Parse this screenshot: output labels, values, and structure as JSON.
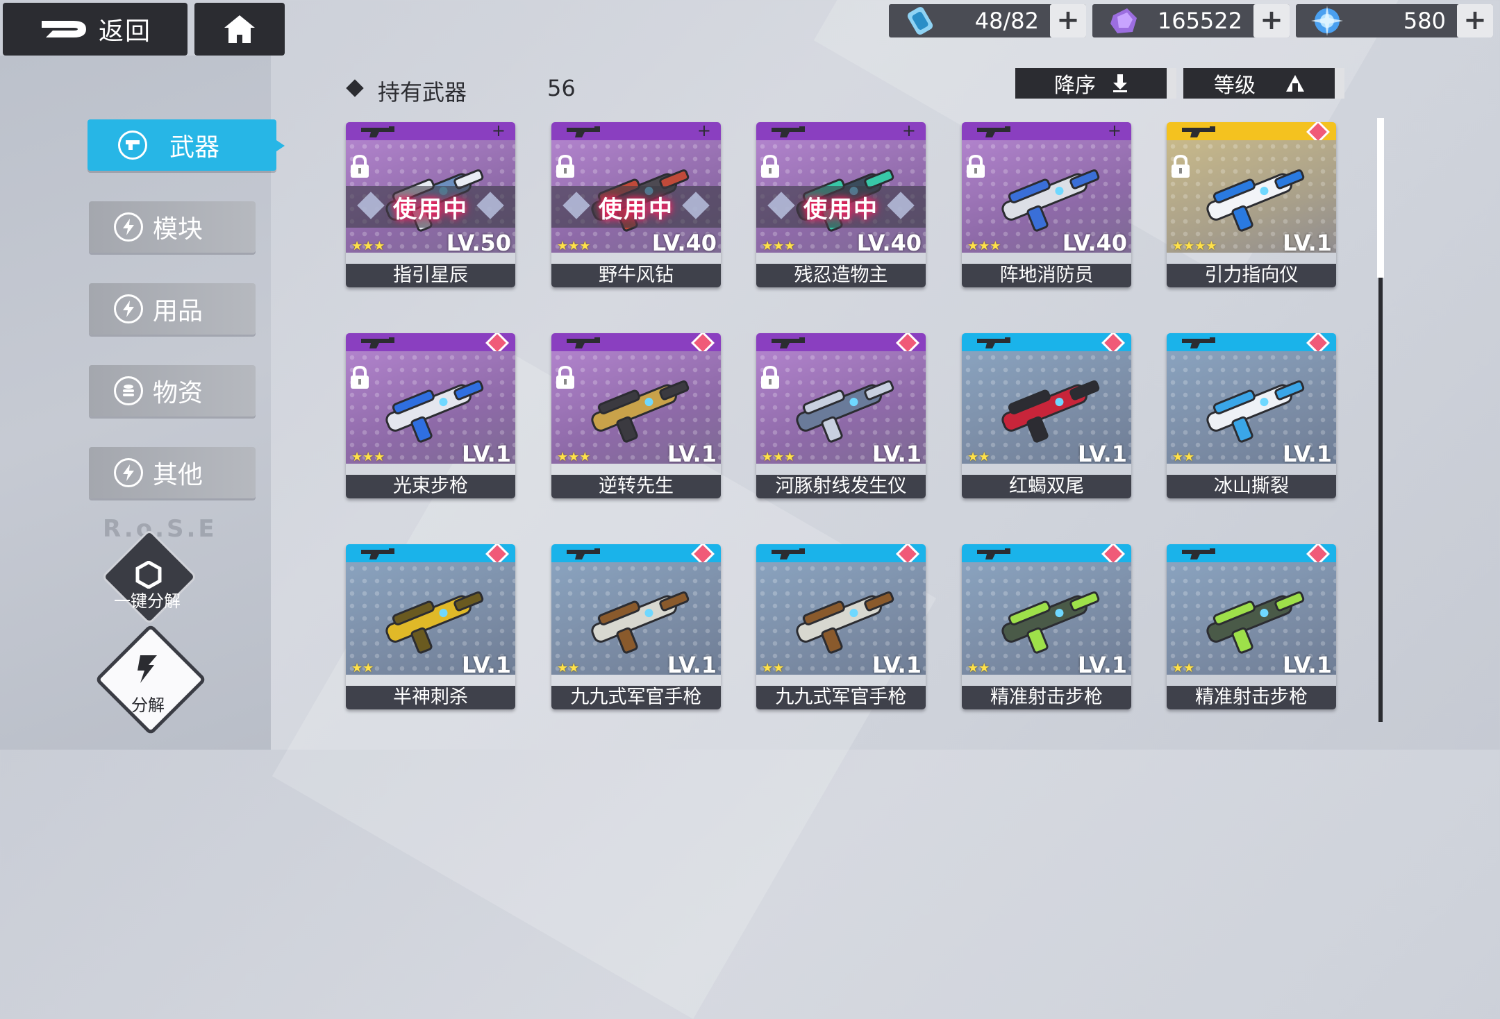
{
  "topbar": {
    "back_label": "返回"
  },
  "resources": [
    {
      "name": "stamina",
      "icon": "hourglass-icon",
      "value": "48/82",
      "color": "#57b8e6"
    },
    {
      "name": "crystal",
      "icon": "crystal-icon",
      "value": "165522",
      "color": "#9c6ee0"
    },
    {
      "name": "orb",
      "icon": "orb-icon",
      "value": "580",
      "color": "#4aa0f0"
    }
  ],
  "sidebar": {
    "items": [
      {
        "label": "武器",
        "icon": "gun-icon",
        "active": true
      },
      {
        "label": "模块",
        "icon": "bolt-icon"
      },
      {
        "label": "用品",
        "icon": "bolt-icon"
      },
      {
        "label": "物资",
        "icon": "stack-icon"
      },
      {
        "label": "其他",
        "icon": "bolt-icon"
      }
    ],
    "one_click_label": "一键分解",
    "decompose_label": "分解",
    "watermark": "R.o.S.E"
  },
  "header": {
    "title": "持有武器",
    "count": "56"
  },
  "sort": {
    "order_label": "降序",
    "type_label": "等级"
  },
  "in_use_label": "使用中",
  "rarity_colors": {
    "purple": "#8a3fc0",
    "gold": "#f4c21f",
    "blue": "#1ab3ea"
  },
  "weapons": [
    {
      "name": "指引星辰",
      "level": "LV.50",
      "stars": "★★★",
      "rarity": "purple",
      "in_use": true,
      "locked": true,
      "mark": "plus"
    },
    {
      "name": "野牛风钻",
      "level": "LV.40",
      "stars": "★★★",
      "rarity": "purple",
      "in_use": true,
      "locked": true,
      "mark": "plus"
    },
    {
      "name": "残忍造物主",
      "level": "LV.40",
      "stars": "★★★",
      "rarity": "purple",
      "in_use": true,
      "locked": true,
      "mark": "plus"
    },
    {
      "name": "阵地消防员",
      "level": "LV.40",
      "stars": "★★★",
      "rarity": "purple",
      "in_use": false,
      "locked": true,
      "mark": "plus"
    },
    {
      "name": "引力指向仪",
      "level": "LV.1",
      "stars": "★★★★",
      "rarity": "gold",
      "in_use": false,
      "locked": true,
      "mark": "new"
    },
    {
      "name": "光束步枪",
      "level": "LV.1",
      "stars": "★★★",
      "rarity": "purple",
      "in_use": false,
      "locked": true,
      "mark": "new"
    },
    {
      "name": "逆转先生",
      "level": "LV.1",
      "stars": "★★★",
      "rarity": "purple",
      "in_use": false,
      "locked": true,
      "mark": "new"
    },
    {
      "name": "河豚射线发生仪",
      "level": "LV.1",
      "stars": "★★★",
      "rarity": "purple",
      "in_use": false,
      "locked": true,
      "mark": "new"
    },
    {
      "name": "红蝎双尾",
      "level": "LV.1",
      "stars": "★★",
      "rarity": "blue",
      "in_use": false,
      "locked": false,
      "mark": "new"
    },
    {
      "name": "冰山撕裂",
      "level": "LV.1",
      "stars": "★★",
      "rarity": "blue",
      "in_use": false,
      "locked": false,
      "mark": "new"
    },
    {
      "name": "半神刺杀",
      "level": "LV.1",
      "stars": "★★",
      "rarity": "blue",
      "in_use": false,
      "locked": false,
      "mark": "new"
    },
    {
      "name": "九九式军官手枪",
      "level": "LV.1",
      "stars": "★★",
      "rarity": "blue",
      "in_use": false,
      "locked": false,
      "mark": "new"
    },
    {
      "name": "九九式军官手枪",
      "level": "LV.1",
      "stars": "★★",
      "rarity": "blue",
      "in_use": false,
      "locked": false,
      "mark": "new"
    },
    {
      "name": "精准射击步枪",
      "level": "LV.1",
      "stars": "★★",
      "rarity": "blue",
      "in_use": false,
      "locked": false,
      "mark": "new"
    },
    {
      "name": "精准射击步枪",
      "level": "LV.1",
      "stars": "★★",
      "rarity": "blue",
      "in_use": false,
      "locked": false,
      "mark": "new"
    }
  ]
}
